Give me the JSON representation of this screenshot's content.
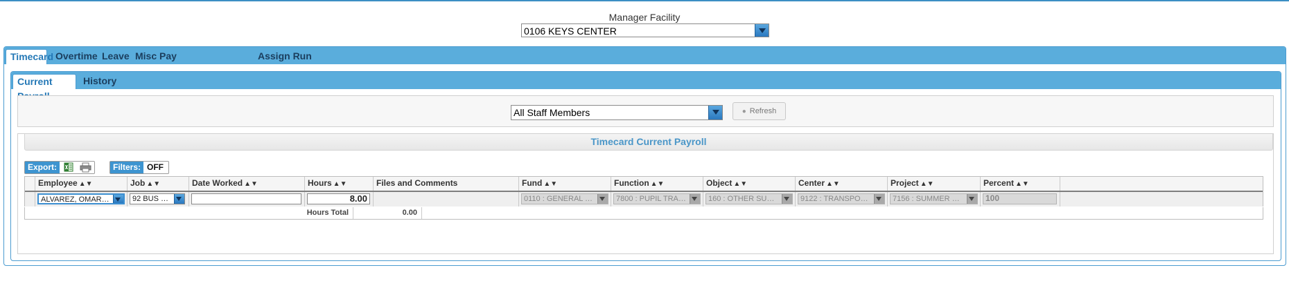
{
  "facility": {
    "label": "Manager Facility",
    "selected": "0106 KEYS CENTER"
  },
  "outer_tabs": [
    {
      "label": "Timecard",
      "active": true
    },
    {
      "label": "Overtime"
    },
    {
      "label": "Leave"
    },
    {
      "label": "Misc Pay"
    },
    {
      "label": "Assign Run"
    }
  ],
  "inner_tabs": [
    {
      "label": "Current Payroll",
      "active": true
    },
    {
      "label": "History"
    }
  ],
  "staff_filter": {
    "selected": "All Staff Members",
    "refresh_label": "Refresh"
  },
  "grid": {
    "title": "Timecard Current Payroll",
    "export_label": "Export:",
    "filters_label": "Filters:",
    "filters_state": "OFF",
    "columns": [
      "Employee",
      "Job",
      "Date Worked",
      "Hours",
      "Files and Comments",
      "Fund",
      "Function",
      "Object",
      "Center",
      "Project",
      "Percent"
    ],
    "row": {
      "employee": "ALVAREZ, OMAR, : ...",
      "job": "92 BUS D...",
      "date_worked": "",
      "hours": "8.00",
      "fund": "0110 : GENERAL F...",
      "function": "7800 : PUPIL TRAN...",
      "object": "160 : OTHER SUPP...",
      "center": "9122 : TRANSPORT...",
      "project": "7156 : SUMMER SC...",
      "percent": "100"
    },
    "totals": {
      "label": "Hours Total",
      "value": "0.00"
    }
  },
  "colors": {
    "accent": "#5aaddc",
    "tab_text_active": "#2478b6",
    "title_text": "#4a96c8"
  }
}
